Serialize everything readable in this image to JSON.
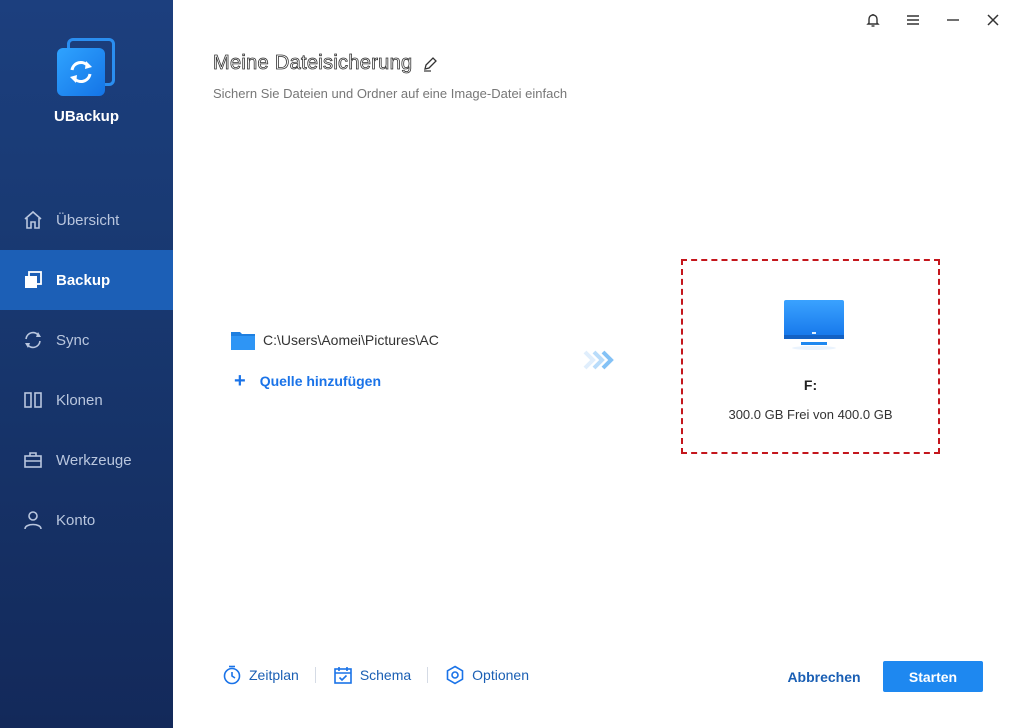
{
  "app": {
    "name": "UBackup",
    "logo_icon": "sync-arrows-icon",
    "accent_color": "#1e88f0",
    "sidebar_color": "#183870"
  },
  "window_controls": {
    "notification_icon": "bell-icon",
    "menu_icon": "menu-icon",
    "minimize_icon": "minimize-icon",
    "close_icon": "close-icon"
  },
  "sidebar": {
    "items": [
      {
        "label": "Übersicht",
        "icon": "home-icon",
        "active": false
      },
      {
        "label": "Backup",
        "icon": "backup-icon",
        "active": true
      },
      {
        "label": "Sync",
        "icon": "sync-icon",
        "active": false
      },
      {
        "label": "Klonen",
        "icon": "clone-icon",
        "active": false
      },
      {
        "label": "Werkzeuge",
        "icon": "toolbox-icon",
        "active": false
      },
      {
        "label": "Konto",
        "icon": "user-icon",
        "active": false
      }
    ]
  },
  "header": {
    "title": "Meine Dateisicherung",
    "subtitle": "Sichern Sie Dateien und Ordner auf eine Image-Datei einfach"
  },
  "source": {
    "path": "C:\\Users\\Aomei\\Pictures\\AC",
    "add_label": "Quelle hinzufügen"
  },
  "destination": {
    "name": "F:",
    "info": "300.0 GB Frei von 400.0 GB",
    "highlight_color": "#c4161c"
  },
  "toolbar": {
    "schedule_label": "Zeitplan",
    "scheme_label": "Schema",
    "options_label": "Optionen",
    "cancel_label": "Abbrechen",
    "start_label": "Starten"
  }
}
